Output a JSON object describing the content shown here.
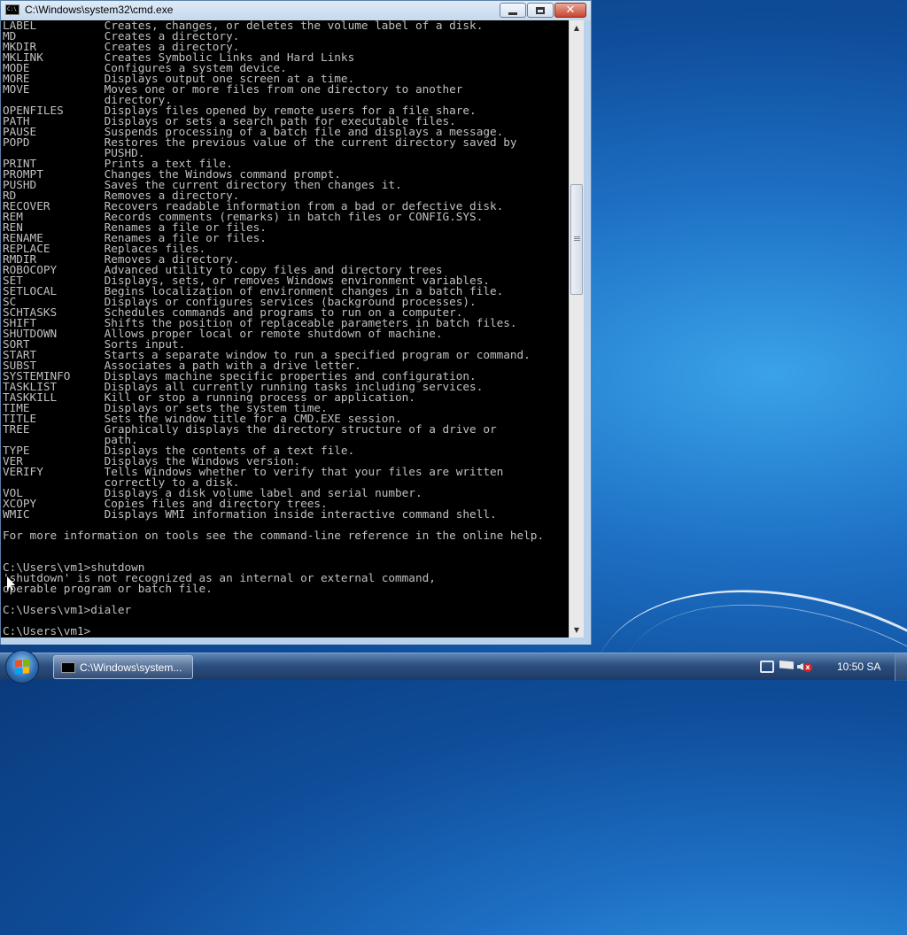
{
  "window": {
    "title": "C:\\Windows\\system32\\cmd.exe",
    "close_glyph": "✕",
    "icon_text": "C:\\"
  },
  "console_text": "LABEL          Creates, changes, or deletes the volume label of a disk.\nMD             Creates a directory.\nMKDIR          Creates a directory.\nMKLINK         Creates Symbolic Links and Hard Links\nMODE           Configures a system device.\nMORE           Displays output one screen at a time.\nMOVE           Moves one or more files from one directory to another\n               directory.\nOPENFILES      Displays files opened by remote users for a file share.\nPATH           Displays or sets a search path for executable files.\nPAUSE          Suspends processing of a batch file and displays a message.\nPOPD           Restores the previous value of the current directory saved by\n               PUSHD.\nPRINT          Prints a text file.\nPROMPT         Changes the Windows command prompt.\nPUSHD          Saves the current directory then changes it.\nRD             Removes a directory.\nRECOVER        Recovers readable information from a bad or defective disk.\nREM            Records comments (remarks) in batch files or CONFIG.SYS.\nREN            Renames a file or files.\nRENAME         Renames a file or files.\nREPLACE        Replaces files.\nRMDIR          Removes a directory.\nROBOCOPY       Advanced utility to copy files and directory trees\nSET            Displays, sets, or removes Windows environment variables.\nSETLOCAL       Begins localization of environment changes in a batch file.\nSC             Displays or configures services (background processes).\nSCHTASKS       Schedules commands and programs to run on a computer.\nSHIFT          Shifts the position of replaceable parameters in batch files.\nSHUTDOWN       Allows proper local or remote shutdown of machine.\nSORT           Sorts input.\nSTART          Starts a separate window to run a specified program or command.\nSUBST          Associates a path with a drive letter.\nSYSTEMINFO     Displays machine specific properties and configuration.\nTASKLIST       Displays all currently running tasks including services.\nTASKKILL       Kill or stop a running process or application.\nTIME           Displays or sets the system time.\nTITLE          Sets the window title for a CMD.EXE session.\nTREE           Graphically displays the directory structure of a drive or\n               path.\nTYPE           Displays the contents of a text file.\nVER            Displays the Windows version.\nVERIFY         Tells Windows whether to verify that your files are written\n               correctly to a disk.\nVOL            Displays a disk volume label and serial number.\nXCOPY          Copies files and directory trees.\nWMIC           Displays WMI information inside interactive command shell.\n\nFor more information on tools see the command-line reference in the online help.\n\n\nC:\\Users\\vm1>shutdown\n'shutdown' is not recognized as an internal or external command,\noperable program or batch file.\n\nC:\\Users\\vm1>dialer\n\nC:\\Users\\vm1>",
  "scrollbar": {
    "up_glyph": "▲",
    "down_glyph": "▼"
  },
  "taskbar": {
    "task_label": "C:\\Windows\\system...",
    "clock": "10:50 SA",
    "vol_glyph": "x"
  },
  "icons": {
    "start": "windows-start-orb",
    "network": "network-icon",
    "action_center": "action-center-flag-icon",
    "volume": "volume-muted-icon"
  },
  "colors": {
    "console_bg": "#000000",
    "console_fg": "#c0c0c0",
    "desktop": "#1d6fc4",
    "close_button": "#c7442d"
  }
}
